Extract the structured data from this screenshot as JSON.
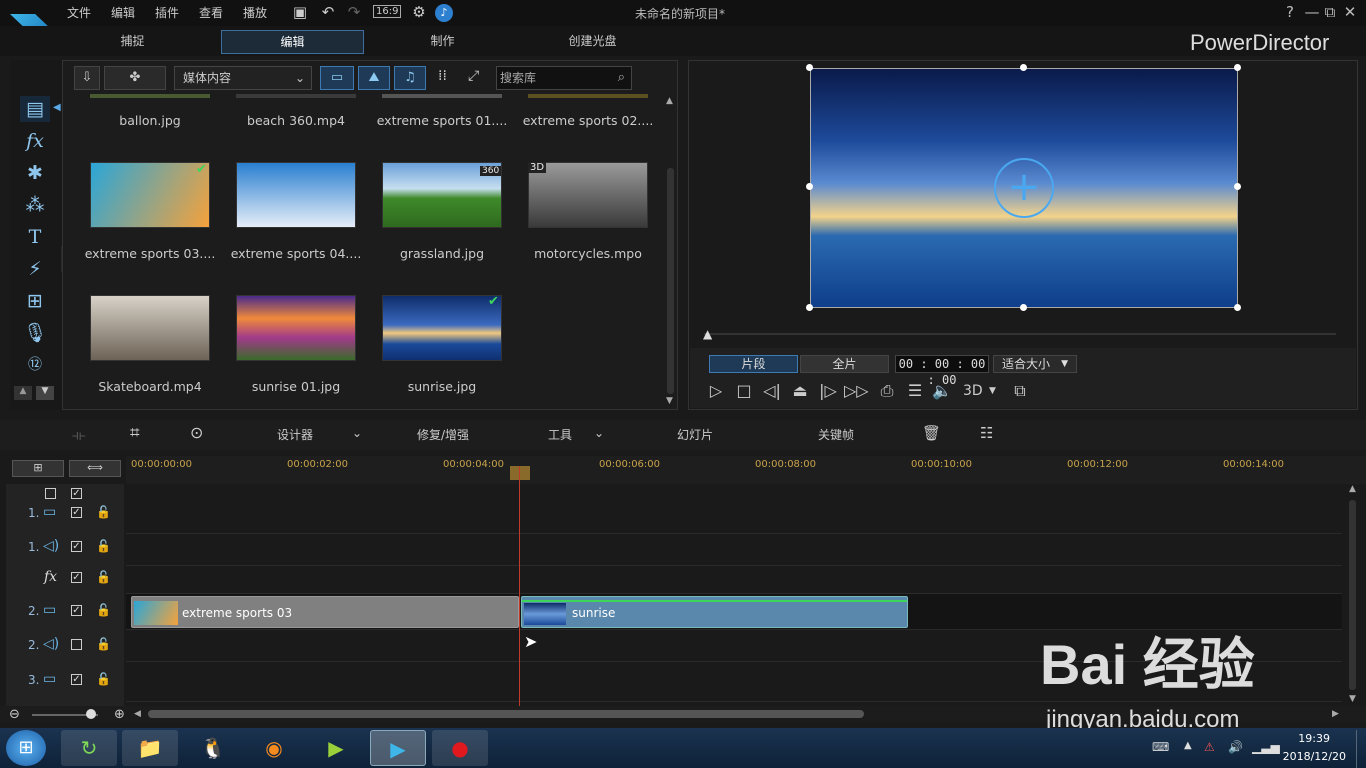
{
  "app": {
    "title": "未命名的新项目*",
    "brand": "PowerDirector",
    "menu": [
      "文件",
      "编辑",
      "插件",
      "查看",
      "播放"
    ],
    "aspect": "16:9",
    "window_buttons": [
      "?",
      "—",
      "⧉",
      "✕"
    ]
  },
  "modes": [
    "捕捉",
    "编辑",
    "制作",
    "创建光盘"
  ],
  "library": {
    "media_select": "媒体内容",
    "search_placeholder": "搜索库",
    "top_row_labels": [
      "ballon.jpg",
      "beach 360.mp4",
      "extreme sports 01....",
      "extreme sports 02...."
    ],
    "items": [
      {
        "label": "extreme sports 03....",
        "badge": "✔",
        "colors": [
          "#2aa6d8",
          "#f6a23b"
        ]
      },
      {
        "label": "extreme sports 04....",
        "badge": "",
        "colors": [
          "#2a7fd0",
          "#e6eef8"
        ]
      },
      {
        "label": "grassland.jpg",
        "badge": "360",
        "colors": [
          "#6aa0d8",
          "#3f8a2a"
        ]
      },
      {
        "label": "motorcycles.mpo",
        "badge": "3D",
        "colors": [
          "#8a8a8a",
          "#4a4a4a"
        ]
      },
      {
        "label": "Skateboard.mp4",
        "badge": "",
        "colors": [
          "#c9c2b6",
          "#6d6356"
        ]
      },
      {
        "label": "sunrise 01.jpg",
        "badge": "",
        "colors": [
          "#f08a3a",
          "#a23a8a"
        ]
      },
      {
        "label": "sunrise.jpg",
        "badge": "✔",
        "colors": [
          "#0f2c6a",
          "#4a8ad0"
        ]
      }
    ]
  },
  "preview": {
    "btn_clip": "片段",
    "btn_full": "全片",
    "timecode": "00 : 00 : 00 : 00",
    "fit": "适合大小",
    "mode_3d": "3D"
  },
  "toolbar": {
    "designer": "设计器",
    "fix": "修复/增强",
    "tools": "工具",
    "slideshow": "幻灯片",
    "keyframe": "关键帧"
  },
  "ruler": [
    "00:00:00:00",
    "00:00:02:00",
    "00:00:04:00",
    "00:00:06:00",
    "00:00:08:00",
    "00:00:10:00",
    "00:00:12:00",
    "00:00:14:00"
  ],
  "tracks": [
    {
      "num": "1.",
      "type": "video-icon"
    },
    {
      "num": "1.",
      "type": "audio-icon"
    },
    {
      "num": "",
      "type": "fx-icon"
    },
    {
      "num": "2.",
      "type": "video-icon"
    },
    {
      "num": "2.",
      "type": "audio-icon"
    },
    {
      "num": "3.",
      "type": "video-icon"
    }
  ],
  "clips": {
    "clip1": "extreme sports 03",
    "clip2": "sunrise"
  },
  "taskbar": {
    "time": "19:39",
    "date": "2018/12/20"
  },
  "watermark": {
    "logo": "Bai 经验",
    "url": "jingyan.baidu.com"
  }
}
